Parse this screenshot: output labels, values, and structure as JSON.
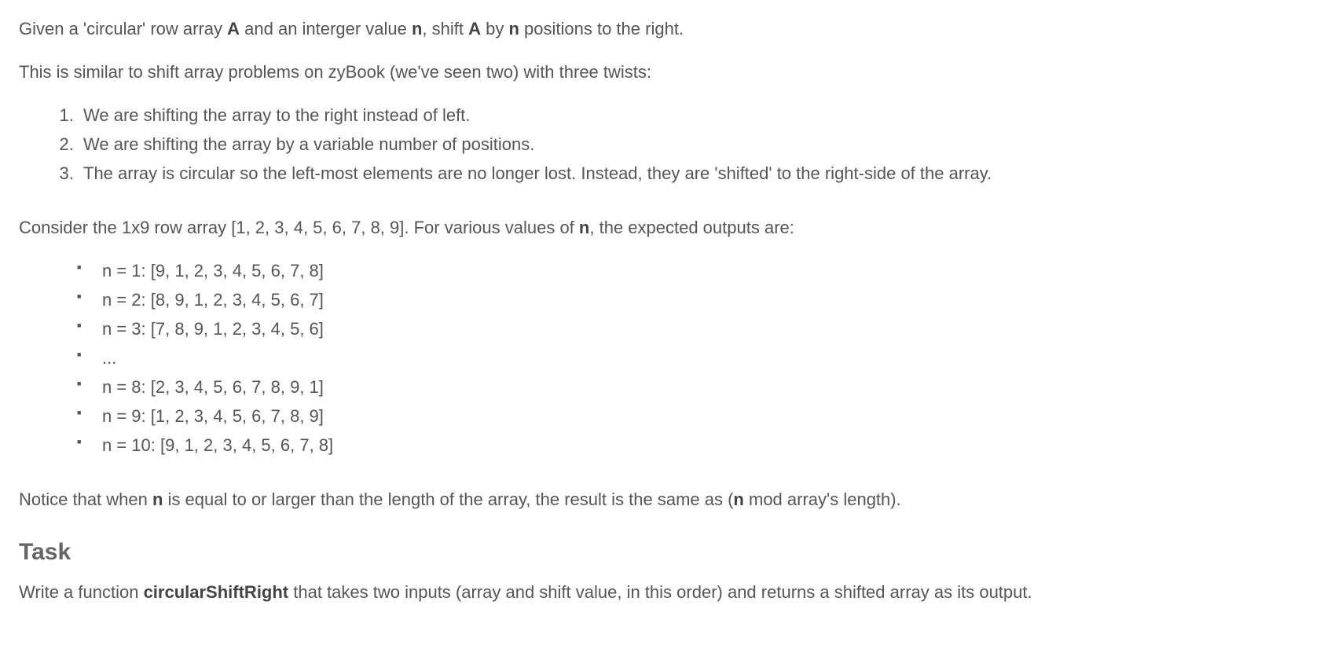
{
  "intro": {
    "p1_part1": "Given a 'circular' row array ",
    "p1_bold1": "A",
    "p1_part2": " and an interger value ",
    "p1_bold2": "n",
    "p1_part3": ", shift ",
    "p1_bold3": "A",
    "p1_part4": " by ",
    "p1_bold4": "n",
    "p1_part5": " positions to the right.",
    "p2": "This is similar to shift array problems on zyBook (we've seen two) with three twists:"
  },
  "twists": [
    "We are shifting the array to the right instead of left.",
    "We are shifting the array by a variable number of positions.",
    "The array is circular so the left-most elements are no longer lost. Instead, they are 'shifted' to the right-side of the array."
  ],
  "consider": {
    "part1": "Consider the 1x9 row array [1, 2, 3, 4, 5, 6, 7, 8, 9]. For various values of ",
    "bold1": "n",
    "part2": ", the expected outputs are:"
  },
  "examples": [
    "n = 1: [9, 1, 2, 3, 4, 5, 6, 7, 8]",
    "n = 2: [8, 9, 1, 2, 3, 4, 5, 6, 7]",
    "n = 3: [7, 8, 9, 1, 2, 3, 4, 5, 6]",
    "...",
    "n = 8: [2, 3, 4, 5, 6, 7, 8, 9, 1]",
    "n = 9: [1, 2, 3, 4, 5, 6, 7, 8, 9]",
    "n = 10: [9, 1, 2, 3, 4, 5, 6, 7, 8]"
  ],
  "notice": {
    "part1": "Notice that when ",
    "bold1": "n",
    "part2": " is equal to or larger than the length of the array, the result is the same as (",
    "bold2": "n",
    "part3": " mod array's length)."
  },
  "task": {
    "heading": "Task",
    "body_part1": "Write a function ",
    "body_bold1": "circularShiftRight",
    "body_part2": " that takes two inputs (array and shift value, in this order) and returns a shifted array as its output."
  }
}
